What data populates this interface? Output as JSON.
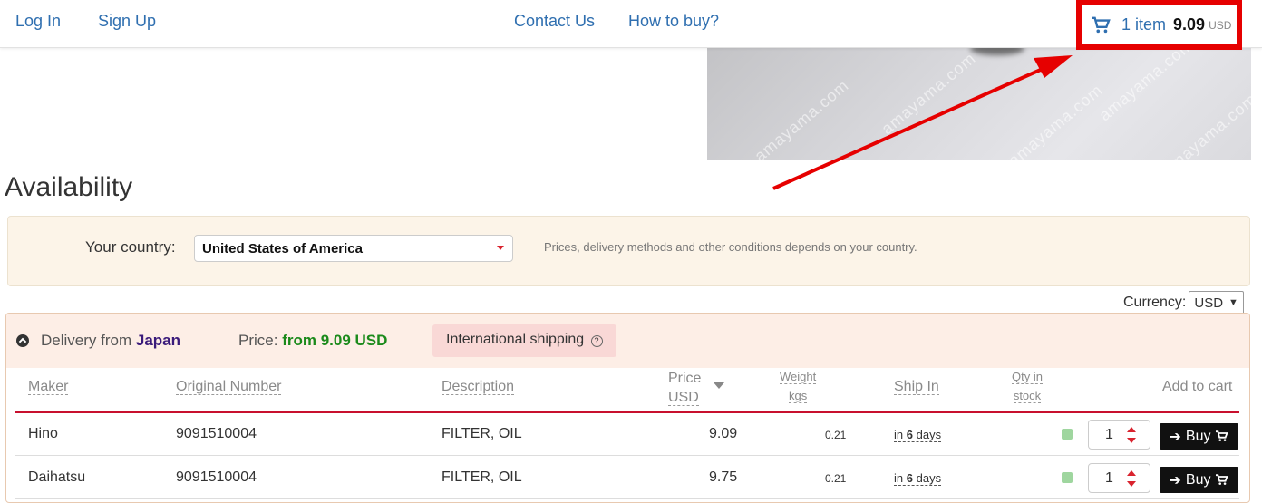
{
  "nav": {
    "login": "Log In",
    "signup": "Sign Up",
    "contact": "Contact Us",
    "how_to_buy": "How to buy?",
    "cart": {
      "count": "1 item",
      "amount": "9.09",
      "currency": "USD"
    }
  },
  "photo": {
    "watermark": "amayama.com"
  },
  "availability": {
    "title": "Availability",
    "country_label": "Your country:",
    "country_value": "United States of America",
    "country_note": "Prices, delivery methods and other conditions depends on your country.",
    "currency_label": "Currency:",
    "currency_value": "USD"
  },
  "delivery": {
    "from_label": "Delivery from",
    "from_country": "Japan",
    "price_label": "Price:",
    "price_value": "from 9.09 USD",
    "shipping_label": "International shipping",
    "shipping_help": "?"
  },
  "table": {
    "headers": {
      "maker": "Maker",
      "original_number": "Original Number",
      "description": "Description",
      "price_top": "Price",
      "price_bottom": "USD",
      "weight_top": "Weight",
      "weight_bottom": "kgs",
      "ship_in": "Ship In",
      "qty_top": "Qty in",
      "qty_bottom": "stock",
      "add_to_cart": "Add to cart"
    },
    "rows": [
      {
        "maker": "Hino",
        "number": "9091510004",
        "description": "FILTER, OIL",
        "price": "9.09",
        "weight": "0.21",
        "ship_prefix": "in",
        "ship_days": "6",
        "ship_suffix": "days",
        "qty": "1",
        "buy": "Buy"
      },
      {
        "maker": "Daihatsu",
        "number": "9091510004",
        "description": "FILTER, OIL",
        "price": "9.75",
        "weight": "0.21",
        "ship_prefix": "in",
        "ship_days": "6",
        "ship_suffix": "days",
        "qty": "1",
        "buy": "Buy"
      }
    ]
  },
  "colors": {
    "highlight": "#e60000",
    "link": "#2f6fb0",
    "price_green": "#1b8a1b",
    "table_rule": "#c8102e"
  }
}
